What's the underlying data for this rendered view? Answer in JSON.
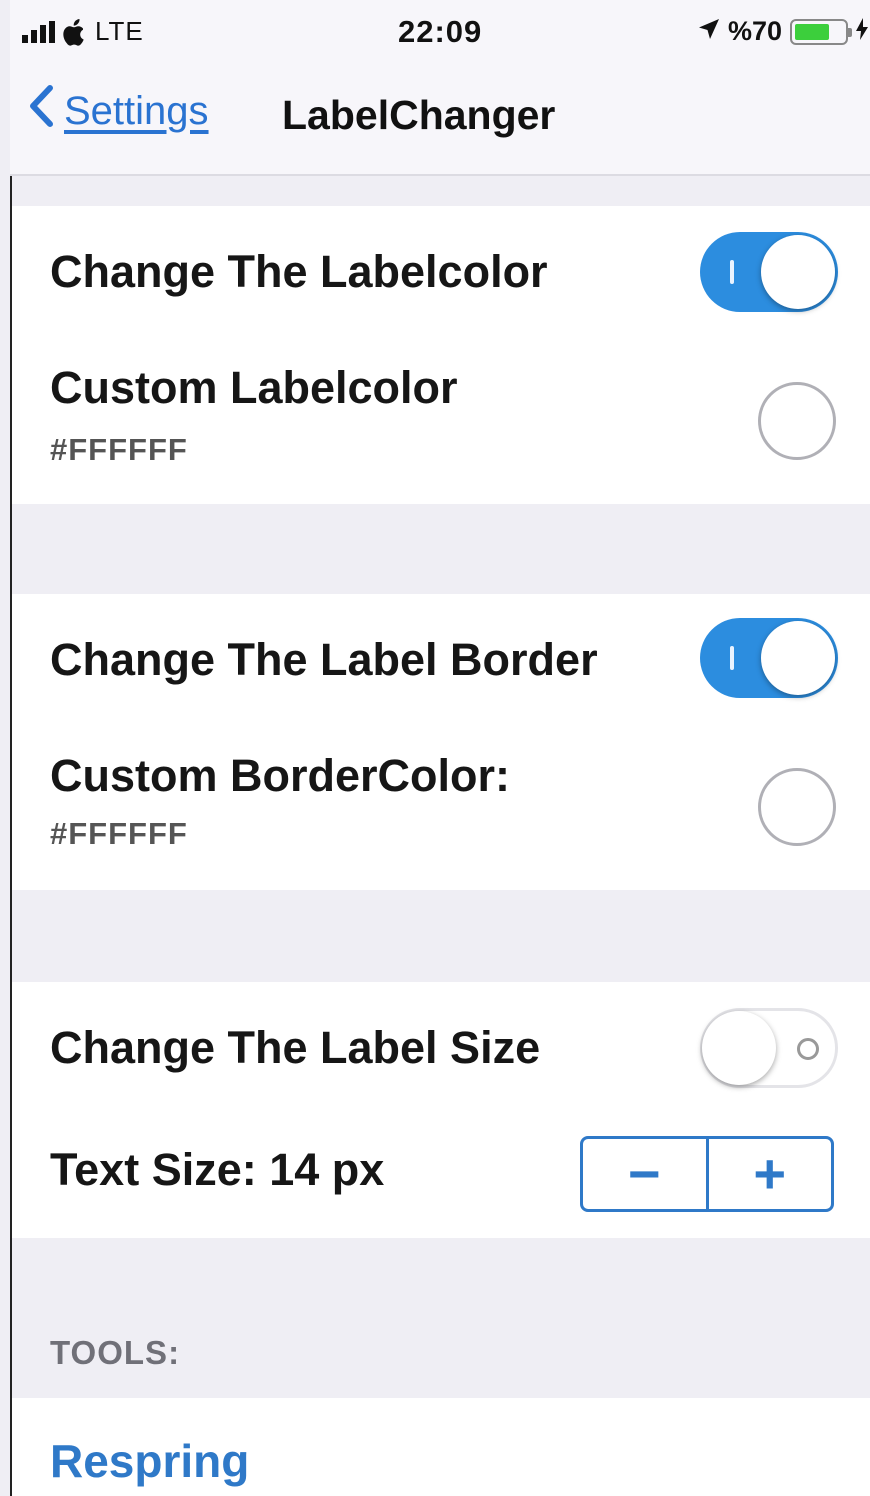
{
  "status_bar": {
    "carrier": "LTE",
    "time": "22:09",
    "battery_text": "%70",
    "battery_level": 0.7,
    "battery_color": "#3ccf3c",
    "icons": [
      "signal-bars-icon",
      "apple-logo-icon",
      "location-arrow-icon",
      "battery-icon",
      "charging-bolt-icon"
    ]
  },
  "nav": {
    "back_label": "Settings",
    "title": "LabelChanger",
    "accent": "#2a73d1"
  },
  "groups": [
    {
      "toggle_row": {
        "label": "Change The Labelcolor",
        "on": true
      },
      "color_row": {
        "label": "Custom Labelcolor",
        "value": "#FFFFFF"
      }
    },
    {
      "toggle_row": {
        "label": "Change The Label Border",
        "on": true
      },
      "color_row": {
        "label": "Custom BorderColor:",
        "value": "#FFFFFF"
      }
    },
    {
      "toggle_row": {
        "label": "Change The Label Size",
        "on": false
      },
      "stepper_row": {
        "label": "Text Size: 14 px",
        "minus": "−",
        "plus": "+"
      }
    }
  ],
  "tools": {
    "header": "TOOLS:",
    "respring": "Respring"
  }
}
